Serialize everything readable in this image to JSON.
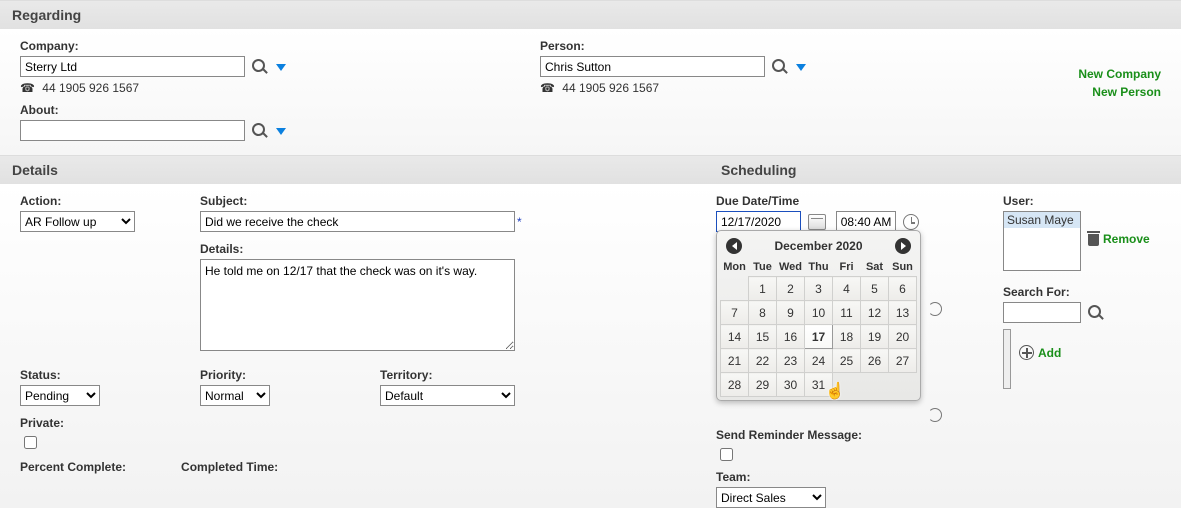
{
  "regarding": {
    "title": "Regarding",
    "company_label": "Company:",
    "company_value": "Sterry Ltd",
    "company_phone": "44 1905 926 1567",
    "about_label": "About:",
    "about_value": "",
    "person_label": "Person:",
    "person_value": "Chris Sutton",
    "person_phone": "44 1905 926 1567",
    "new_company": "New Company",
    "new_person": "New Person"
  },
  "details": {
    "title": "Details",
    "action_label": "Action:",
    "action_value": "AR Follow up",
    "subject_label": "Subject:",
    "subject_value": "Did we receive the check",
    "details_label": "Details:",
    "details_value": "He told me on 12/17 that the check was on it's way.",
    "status_label": "Status:",
    "status_value": "Pending",
    "priority_label": "Priority:",
    "priority_value": "Normal",
    "territory_label": "Territory:",
    "territory_value": "Default",
    "private_label": "Private:",
    "percent_label": "Percent Complete:",
    "completed_label": "Completed Time:"
  },
  "scheduling": {
    "title": "Scheduling",
    "due_label": "Due Date/Time",
    "due_date": "12/17/2020",
    "due_time": "08:40 AM",
    "calendar": {
      "title": "December 2020",
      "dow": [
        "Mon",
        "Tue",
        "Wed",
        "Thu",
        "Fri",
        "Sat",
        "Sun"
      ],
      "rows": [
        [
          "",
          "1",
          "2",
          "3",
          "4",
          "5",
          "6"
        ],
        [
          "7",
          "8",
          "9",
          "10",
          "11",
          "12",
          "13"
        ],
        [
          "14",
          "15",
          "16",
          "17",
          "18",
          "19",
          "20"
        ],
        [
          "21",
          "22",
          "23",
          "24",
          "25",
          "26",
          "27"
        ],
        [
          "28",
          "29",
          "30",
          "31",
          "",
          "",
          ""
        ]
      ],
      "selected": "17"
    },
    "reminder_label": "Send Reminder Message:",
    "team_label": "Team:",
    "team_value": "Direct Sales",
    "user_label": "User:",
    "user_value": "Susan Maye",
    "remove": "Remove",
    "search_label": "Search For:",
    "add": "Add"
  }
}
